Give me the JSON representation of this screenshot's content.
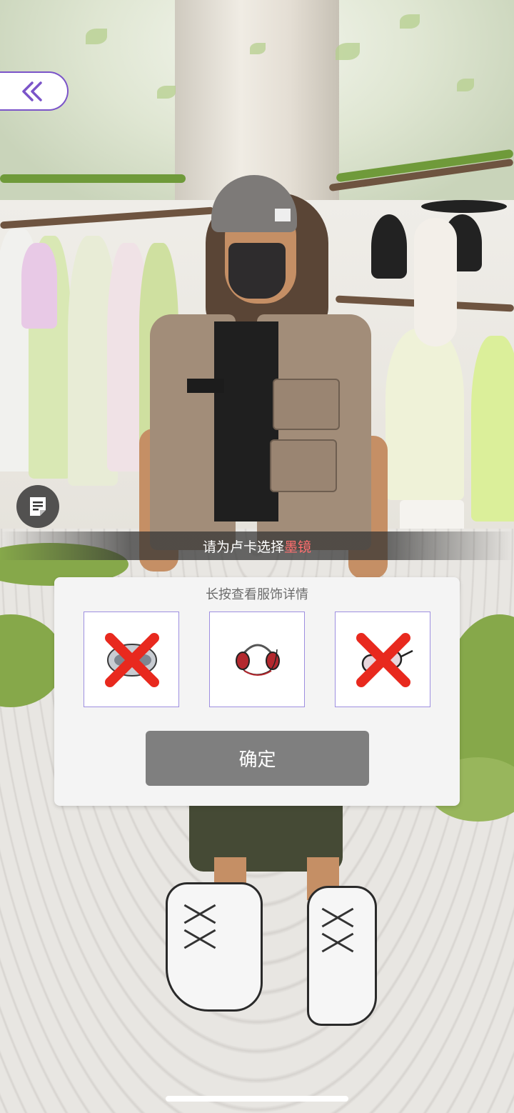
{
  "navigation": {
    "back_icon": "double-chevron-left-icon",
    "back_color": "#7b54c9",
    "notes_icon": "notes-icon"
  },
  "prompt": {
    "prefix": "请为卢卡选择",
    "highlight": "墨镜",
    "highlight_color": "#ff6f6f"
  },
  "selection_panel": {
    "hint": "长按查看服饰详情",
    "options": [
      {
        "item": "mask-item-icon",
        "state": "unavailable",
        "mark": "red-x-icon"
      },
      {
        "item": "headset-item-icon",
        "state": "available",
        "mark": ""
      },
      {
        "item": "glasses-item-icon",
        "state": "unavailable",
        "mark": "red-x-icon"
      }
    ],
    "confirm_label": "确定",
    "border_color": "#9e8fe0"
  }
}
